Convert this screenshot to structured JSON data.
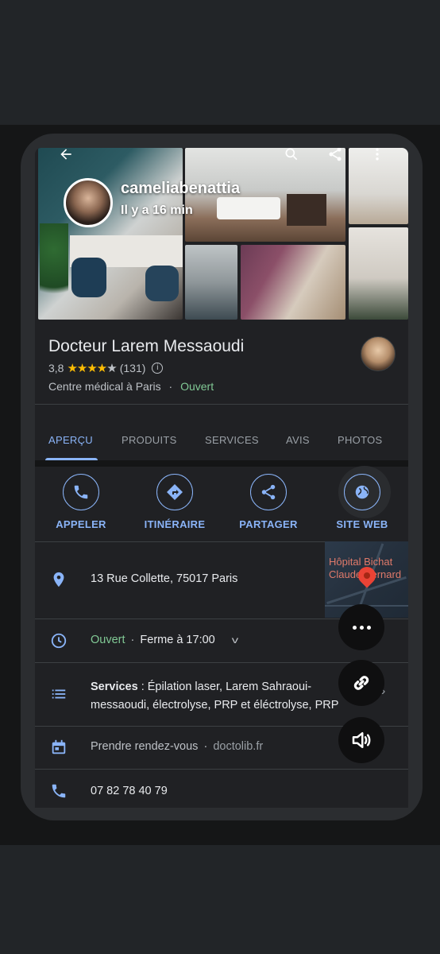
{
  "gallery": {
    "story_user": "cameliabenattia",
    "story_time": "Il y a 16 min",
    "icons": [
      "back-arrow-icon",
      "search-icon",
      "share-icon",
      "more-vert-icon"
    ]
  },
  "place": {
    "name": "Docteur Larem Messaoudi",
    "rating": "3,8",
    "reviews": "(131)",
    "category": "Centre médical à Paris",
    "separator": "·",
    "status": "Ouvert"
  },
  "tabs": [
    {
      "label": "APERÇU"
    },
    {
      "label": "PRODUITS"
    },
    {
      "label": "SERVICES"
    },
    {
      "label": "AVIS"
    },
    {
      "label": "PHOTOS"
    }
  ],
  "actions": [
    {
      "label": "APPELER",
      "icon": "phone-icon"
    },
    {
      "label": "ITINÉRAIRE",
      "icon": "directions-icon"
    },
    {
      "label": "PARTAGER",
      "icon": "share-icon"
    },
    {
      "label": "SITE WEB",
      "icon": "globe-icon"
    }
  ],
  "address": {
    "text": "13 Rue Collette, 75017 Paris",
    "map_label_line1": "Hôpital Bichat",
    "map_label_line2": "Claude Bernard"
  },
  "hours": {
    "status": "Ouvert",
    "separator": "·",
    "closes": "Ferme à 17:00"
  },
  "services": {
    "label": "Services",
    "text_line1": " : Épilation laser, Larem Sahraoui-",
    "text_line2": "messaoudi, électrolyse, PRP et éléctrolyse, PRP"
  },
  "booking": {
    "text": "Prendre rendez-vous",
    "separator": "·",
    "domain": "doctolib.fr"
  },
  "phone": {
    "number": "07 82 78 40 79"
  },
  "colors": {
    "accent": "#8ab4f8",
    "open": "#81c995",
    "star": "#fbbc04",
    "background": "#202124"
  }
}
